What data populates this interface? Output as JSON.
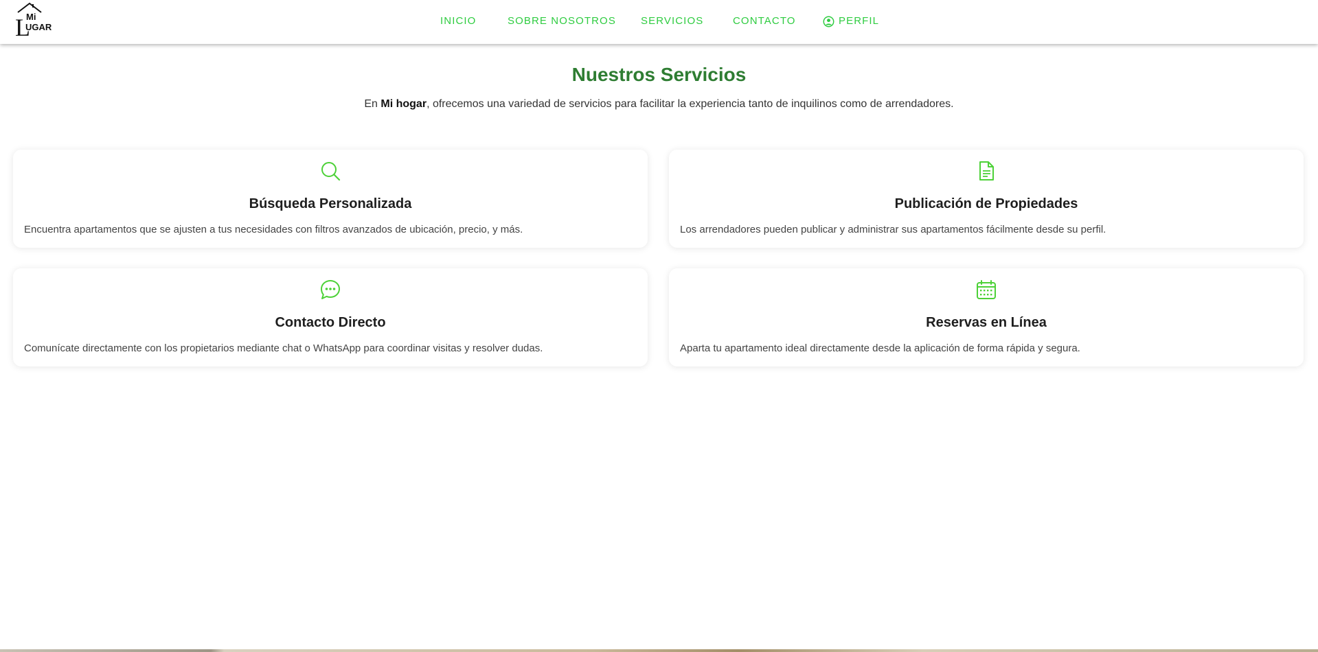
{
  "brand": {
    "logo_text_top": "Mi",
    "logo_text_bottom": "UGAR",
    "logo_letter": "L"
  },
  "nav": {
    "items": [
      {
        "label": "INICIO"
      },
      {
        "label": "SOBRE NOSOTROS"
      },
      {
        "label": "SERVICIOS"
      },
      {
        "label": "CONTACTO"
      },
      {
        "label": "PERFIL",
        "icon": "user-circle-icon"
      }
    ],
    "color": "#2ecc40"
  },
  "services": {
    "title": "Nuestros Servicios",
    "intro_prefix": "En ",
    "intro_brand": "Mi hogar",
    "intro_suffix": ", ofrecemos una variedad de servicios para facilitar la experiencia tanto de inquilinos como de arrendadores.",
    "title_color": "#2e7d32",
    "icon_color": "#4cd137",
    "cards": [
      {
        "icon": "search-icon",
        "title": "Búsqueda Personalizada",
        "description": "Encuentra apartamentos que se ajusten a tus necesidades con filtros avanzados de ubicación, precio, y más."
      },
      {
        "icon": "document-icon",
        "title": "Publicación de Propiedades",
        "description": "Los arrendadores pueden publicar y administrar sus apartamentos fácilmente desde su perfil."
      },
      {
        "icon": "chat-icon",
        "title": "Contacto Directo",
        "description": "Comunícate directamente con los propietarios mediante chat o WhatsApp para coordinar visitas y resolver dudas."
      },
      {
        "icon": "calendar-icon",
        "title": "Reservas en Línea",
        "description": "Aparta tu apartamento ideal directamente desde la aplicación de forma rápida y segura."
      }
    ]
  }
}
